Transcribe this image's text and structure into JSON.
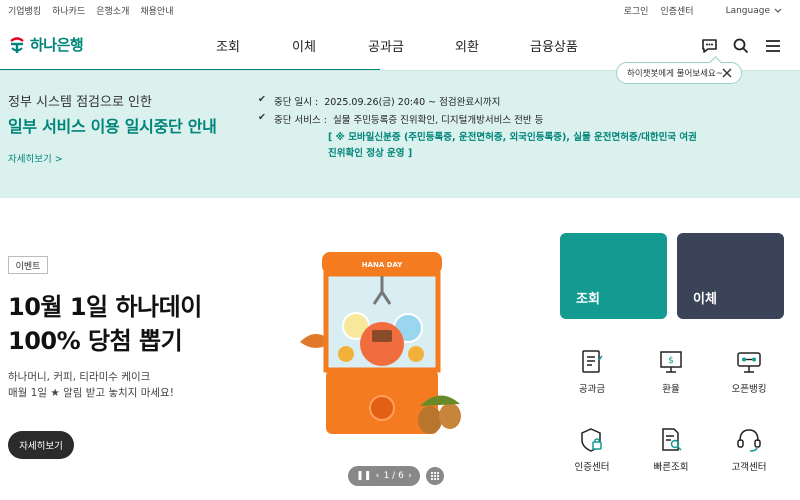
{
  "util": {
    "left": [
      "기업뱅킹",
      "하나카드",
      "은행소개",
      "채용안내"
    ],
    "right": [
      "로그인",
      "인증센터"
    ],
    "language": "Language"
  },
  "header": {
    "logo": "하나은행",
    "nav": [
      "조회",
      "이체",
      "공과금",
      "외환",
      "금융상품"
    ]
  },
  "chat_tip": "하이챗봇에게 물어보세요~",
  "notice": {
    "line1": "정부 시스템 점검으로 인한",
    "line2": "일부 서비스 이용 일시중단 안내",
    "more": "자세히보기 >",
    "items": [
      {
        "label": "중단  일시 :",
        "text": "2025.09.26(금) 20:40 ~ 점검완료시까지"
      },
      {
        "label": "중단 서비스 :",
        "text": "실물 주민등록증 진위확인, 디지털개방서비스 전반 등"
      }
    ],
    "sub1": "[ ※ 모바일신분증 (주민등록증, 운전면허증, 외국인등록증), 실물 운전면허증/대한민국 여권",
    "sub2": "진위확인 정상 운영 ]"
  },
  "event": {
    "badge": "이벤트",
    "title1": "10월 1일 하나데이",
    "title2": "100% 당첨 뽑기",
    "desc1": "하나머니, 커피, 티라미수 케이크",
    "desc2": "매월 1일 ★ 알림 받고 놓치지 마세요!",
    "button": "자세히보기",
    "machine_label": "HANA DAY"
  },
  "pager": {
    "text": "1 / 6"
  },
  "tiles": [
    {
      "label": "조회",
      "color": "#139b92"
    },
    {
      "label": "이체",
      "color": "#3b4358"
    }
  ],
  "quick_menu": [
    {
      "label": "공과금",
      "icon": "bill-icon"
    },
    {
      "label": "환율",
      "icon": "exchange-rate-icon"
    },
    {
      "label": "오픈뱅킹",
      "icon": "open-banking-icon"
    },
    {
      "label": "인증센터",
      "icon": "certificate-icon"
    },
    {
      "label": "빠른조회",
      "icon": "quick-search-icon"
    },
    {
      "label": "고객센터",
      "icon": "headset-icon"
    }
  ],
  "colors": {
    "brand": "#00857a",
    "notice_bg": "#dbf1ee",
    "tile_teal": "#139b92",
    "tile_navy": "#3b4358"
  }
}
